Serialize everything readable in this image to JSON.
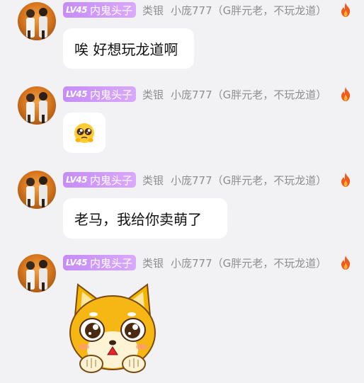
{
  "messages": [
    {
      "level": "LV45",
      "title": "内鬼头子",
      "rank": "类银",
      "nickname": "小庞777（G胖元老，不玩龙道）",
      "text": "唉 好想玩龙道啊"
    },
    {
      "level": "LV45",
      "title": "内鬼头子",
      "rank": "类银",
      "nickname": "小庞777（G胖元老，不玩龙道）",
      "emoji": "pleading-face-emoji"
    },
    {
      "level": "LV45",
      "title": "内鬼头子",
      "rank": "类银",
      "nickname": "小庞777（G胖元老，不玩龙道）",
      "text": "老马，我给你卖萌了"
    },
    {
      "level": "LV45",
      "title": "内鬼头子",
      "rank": "类银",
      "nickname": "小庞777（G胖元老，不玩龙道）",
      "sticker": "shiba-pleading-sticker"
    }
  ],
  "colors": {
    "background": "#f2f2f4",
    "badge": "#c58cf7",
    "meta_text": "#8e8e93",
    "fire": "#f05a1a"
  }
}
